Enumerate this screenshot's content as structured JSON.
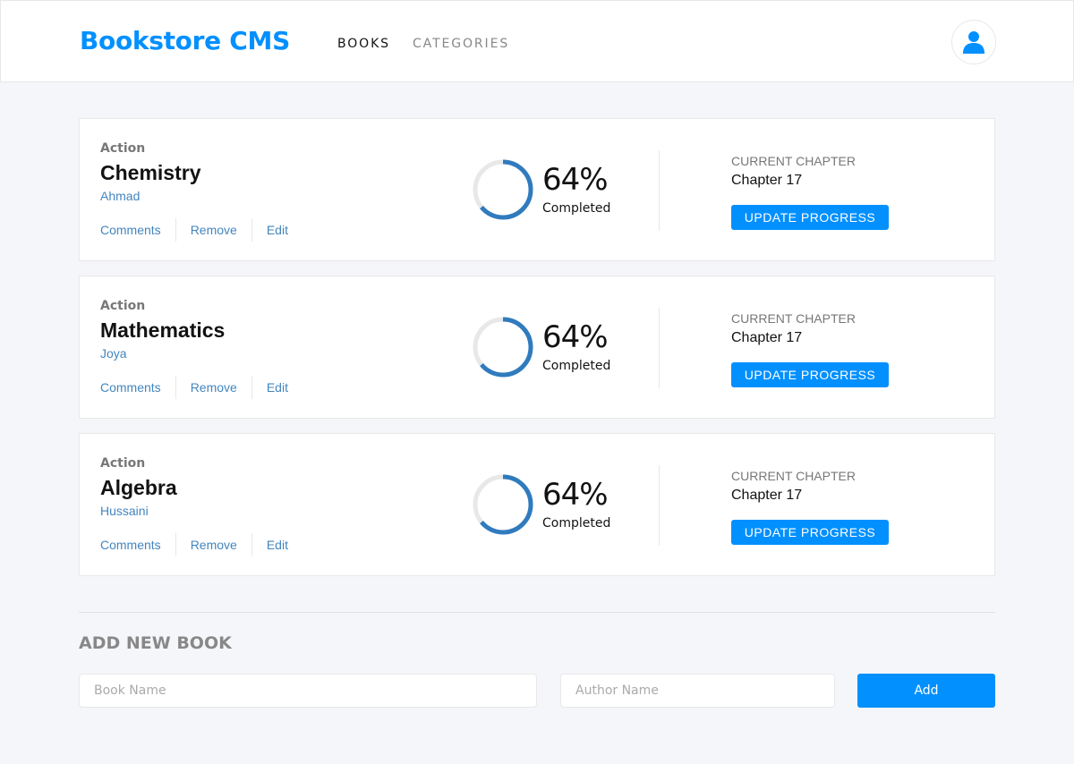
{
  "header": {
    "brand": "Bookstore CMS",
    "nav": [
      {
        "label": "BOOKS",
        "active": true
      },
      {
        "label": "CATEGORIES",
        "active": false
      }
    ],
    "user_icon": "user-icon"
  },
  "colors": {
    "accent": "#0290ff",
    "link": "#4386bf",
    "ring_track": "#e8e8e8",
    "ring_progress": "#307bbe"
  },
  "books": [
    {
      "genre": "Action",
      "title": "Chemistry",
      "author": "Ahmad",
      "actions": [
        "Comments",
        "Remove",
        "Edit"
      ],
      "percent_text": "64%",
      "progress": 0.64,
      "completed_label": "Completed",
      "chapter_label": "CURRENT CHAPTER",
      "chapter": "Chapter 17",
      "update_label": "UPDATE PROGRESS"
    },
    {
      "genre": "Action",
      "title": "Mathematics",
      "author": "Joya",
      "actions": [
        "Comments",
        "Remove",
        "Edit"
      ],
      "percent_text": "64%",
      "progress": 0.64,
      "completed_label": "Completed",
      "chapter_label": "CURRENT CHAPTER",
      "chapter": "Chapter 17",
      "update_label": "UPDATE PROGRESS"
    },
    {
      "genre": "Action",
      "title": "Algebra",
      "author": "Hussaini",
      "actions": [
        "Comments",
        "Remove",
        "Edit"
      ],
      "percent_text": "64%",
      "progress": 0.64,
      "completed_label": "Completed",
      "chapter_label": "CURRENT CHAPTER",
      "chapter": "Chapter 17",
      "update_label": "UPDATE PROGRESS"
    }
  ],
  "add_form": {
    "title": "ADD NEW BOOK",
    "book_placeholder": "Book Name",
    "book_value": "",
    "author_placeholder": "Author Name",
    "author_value": "",
    "submit_label": "Add"
  }
}
